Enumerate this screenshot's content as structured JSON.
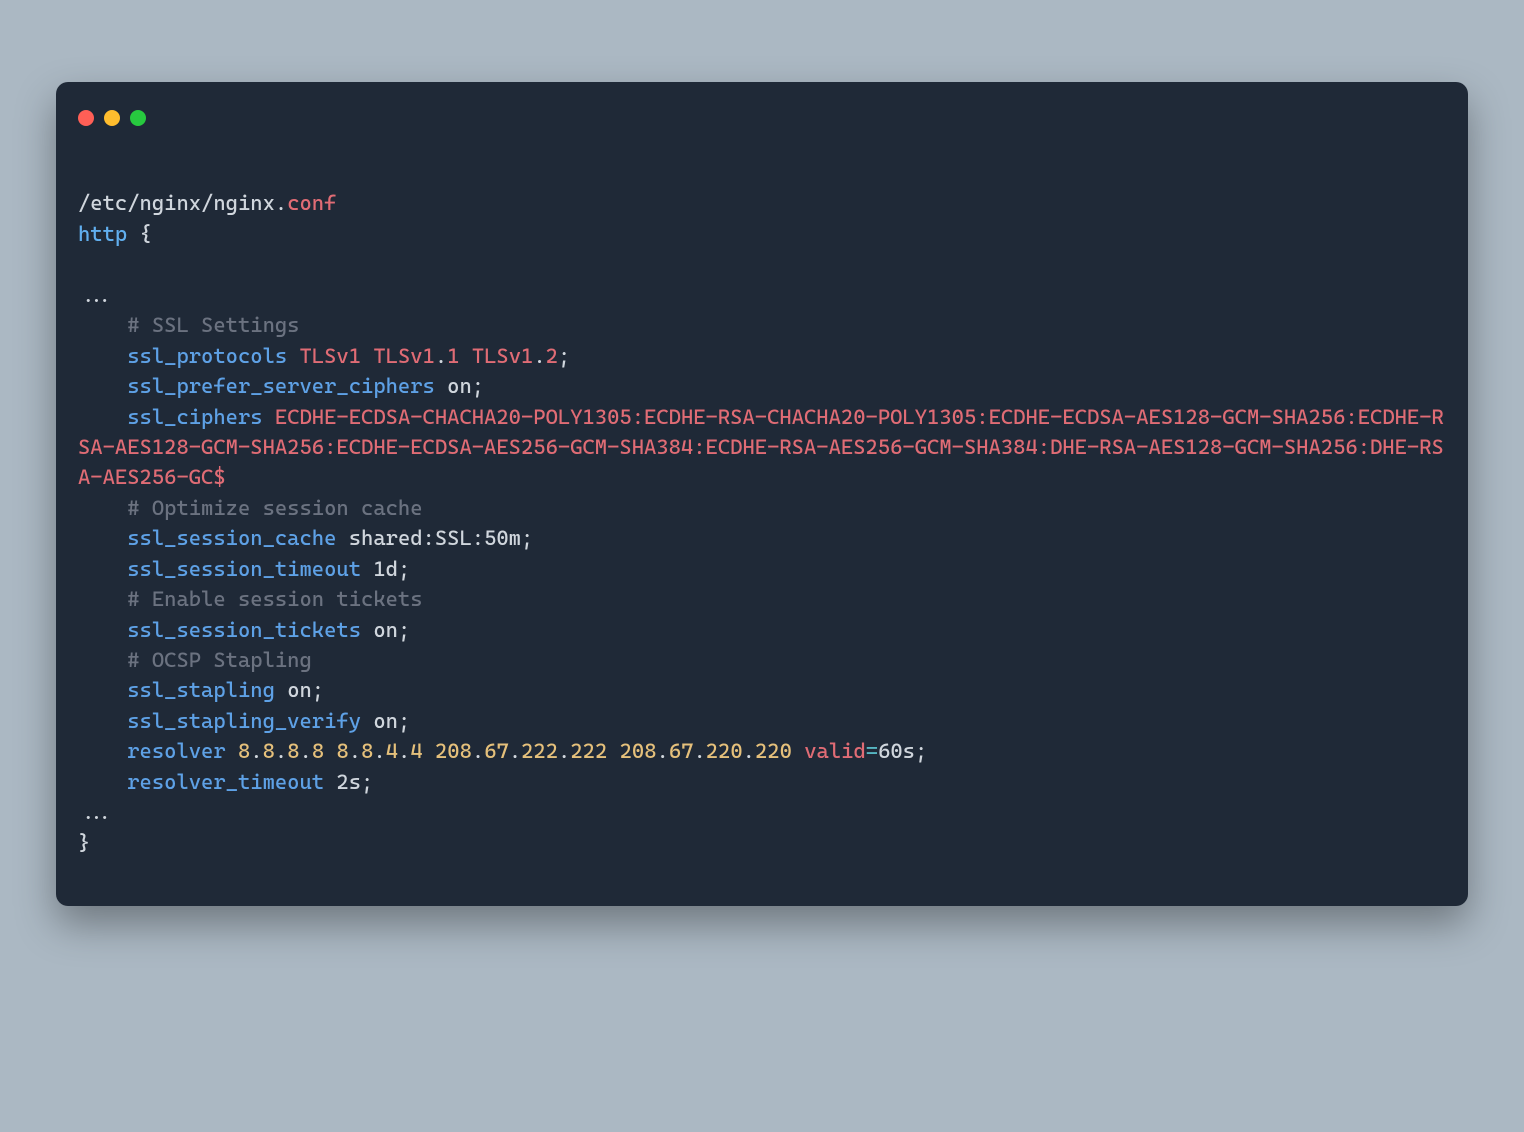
{
  "file": {
    "path": "/etc/nginx/nginx",
    "dot": ".",
    "ext": "conf"
  },
  "http_open": {
    "kw": "http",
    "brace": " {"
  },
  "ellipsis": "...",
  "l_ssl_settings": "    # SSL Settings",
  "l_protocols": {
    "indent": "    ",
    "dir": "ssl_protocols",
    "sp1": " ",
    "v1": "TLSv1",
    "sp2": " ",
    "v2": "TLSv1",
    "d2": ".",
    "m2": "1",
    "sp3": " ",
    "v3": "TLSv1",
    "d3": ".",
    "m3": "2",
    "semi": ";"
  },
  "l_prefer": {
    "indent": "    ",
    "dir": "ssl_prefer_server_ciphers",
    "sp": " ",
    "on": "on",
    "semi": ";"
  },
  "l_ciphers": {
    "indent": "    ",
    "dir": "ssl_ciphers",
    "sp": " ",
    "value": "ECDHE-ECDSA-CHACHA20-POLY1305:ECDHE-RSA-CHACHA20-POLY1305:ECDHE-ECDSA-AES128-GCM-SHA256:ECDHE-RSA-AES128-GCM-SHA256:ECDHE-ECDSA-AES256-GCM-SHA384:ECDHE-RSA-AES256-GCM-SHA384:DHE-RSA-AES128-GCM-SHA256:DHE-RSA-AES256-GC$"
  },
  "l_opt_cache": "    # Optimize session cache",
  "l_sess_cache": {
    "indent": "    ",
    "dir": "ssl_session_cache",
    "sp": " ",
    "val": "shared:SSL:50m",
    "semi": ";"
  },
  "l_sess_timeout": {
    "indent": "    ",
    "dir": "ssl_session_timeout",
    "sp": " ",
    "val": "1d",
    "semi": ";"
  },
  "l_tickets_cmt": "    # Enable session tickets",
  "l_tickets": {
    "indent": "    ",
    "dir": "ssl_session_tickets",
    "sp": " ",
    "on": "on",
    "semi": ";"
  },
  "l_ocsp_cmt": "    # OCSP Stapling",
  "l_stapling": {
    "indent": "    ",
    "dir": "ssl_stapling",
    "sp": " ",
    "on": "on",
    "semi": ";"
  },
  "l_stapling_verify": {
    "indent": "    ",
    "dir": "ssl_stapling_verify",
    "sp": " ",
    "on": "on",
    "semi": ";"
  },
  "l_resolver": {
    "indent": "    ",
    "dir": "resolver",
    "tokens": [
      {
        "t": " ",
        "c": "plain"
      },
      {
        "t": "8",
        "c": "num"
      },
      {
        "t": ".",
        "c": "plain"
      },
      {
        "t": "8",
        "c": "num"
      },
      {
        "t": ".",
        "c": "plain"
      },
      {
        "t": "8",
        "c": "num"
      },
      {
        "t": ".",
        "c": "plain"
      },
      {
        "t": "8",
        "c": "num"
      },
      {
        "t": " ",
        "c": "plain"
      },
      {
        "t": "8",
        "c": "num"
      },
      {
        "t": ".",
        "c": "plain"
      },
      {
        "t": "8",
        "c": "num"
      },
      {
        "t": ".",
        "c": "plain"
      },
      {
        "t": "4",
        "c": "num"
      },
      {
        "t": ".",
        "c": "plain"
      },
      {
        "t": "4",
        "c": "num"
      },
      {
        "t": " ",
        "c": "plain"
      },
      {
        "t": "208",
        "c": "num"
      },
      {
        "t": ".",
        "c": "plain"
      },
      {
        "t": "67",
        "c": "num"
      },
      {
        "t": ".",
        "c": "plain"
      },
      {
        "t": "222",
        "c": "num"
      },
      {
        "t": ".",
        "c": "plain"
      },
      {
        "t": "222",
        "c": "num"
      },
      {
        "t": " ",
        "c": "plain"
      },
      {
        "t": "208",
        "c": "num"
      },
      {
        "t": ".",
        "c": "plain"
      },
      {
        "t": "67",
        "c": "num"
      },
      {
        "t": ".",
        "c": "plain"
      },
      {
        "t": "220",
        "c": "num"
      },
      {
        "t": ".",
        "c": "plain"
      },
      {
        "t": "220",
        "c": "num"
      },
      {
        "t": " ",
        "c": "plain"
      },
      {
        "t": "valid",
        "c": "val"
      },
      {
        "t": "=",
        "c": "op"
      },
      {
        "t": "60s",
        "c": "plain"
      },
      {
        "t": ";",
        "c": "plain"
      }
    ]
  },
  "l_resolver_to": {
    "indent": "    ",
    "dir": "resolver_timeout",
    "sp": " ",
    "val": "2s",
    "semi": ";"
  },
  "close_brace": "}"
}
